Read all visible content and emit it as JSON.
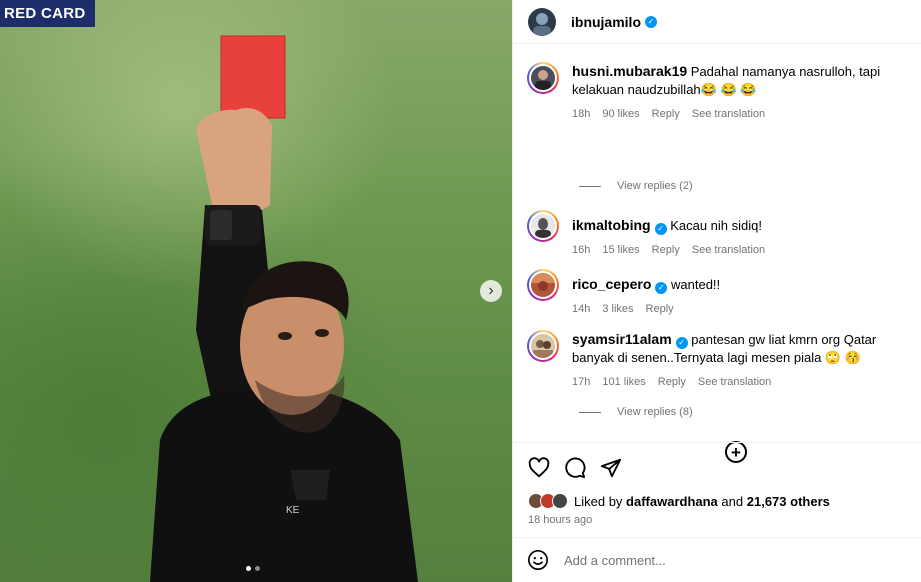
{
  "media": {
    "banner_text": "RED CARD",
    "next_icon": "chevron-right-icon",
    "slides": 2,
    "active_slide": 1
  },
  "post": {
    "author": "ibnujamilo",
    "verified": true
  },
  "comments": [
    {
      "username": "husni.mubarak19",
      "verified": false,
      "text": "Padahal namanya nasrulloh, tapi kelakuan naudzubillah😂 😂 😂",
      "time": "18h",
      "likes": "90 likes",
      "reply": "Reply",
      "translate": "See translation",
      "view_replies": "View replies (2)"
    },
    {
      "username": "ikmaltobing",
      "verified": true,
      "text": "Kacau nih sidiq!",
      "time": "16h",
      "likes": "15 likes",
      "reply": "Reply",
      "translate": "See translation"
    },
    {
      "username": "rico_cepero",
      "verified": true,
      "text": "wanted!!",
      "time": "14h",
      "likes": "3 likes",
      "reply": "Reply"
    },
    {
      "username": "syamsir11alam",
      "verified": true,
      "text": "pantesan gw liat kmrn org Qatar banyak di senen..Ternyata lagi mesen piala 🙄 😚",
      "time": "17h",
      "likes": "101 likes",
      "reply": "Reply",
      "translate": "See translation",
      "view_replies": "View replies (8)"
    }
  ],
  "actions": {
    "icons": [
      "heart-icon",
      "comment-icon",
      "share-icon"
    ],
    "liked_by_prefix": "Liked by",
    "liked_by_user": "daffawardhana",
    "liked_by_and": "and",
    "liked_by_others": "21,673 others",
    "time_ago": "18 hours ago"
  },
  "add_comment": {
    "placeholder": "Add a comment..."
  },
  "colors": {
    "link_gray": "#737373",
    "verified_blue": "#0095f6",
    "banner_blue": "#1d2c6b",
    "card_red": "#e53935"
  }
}
